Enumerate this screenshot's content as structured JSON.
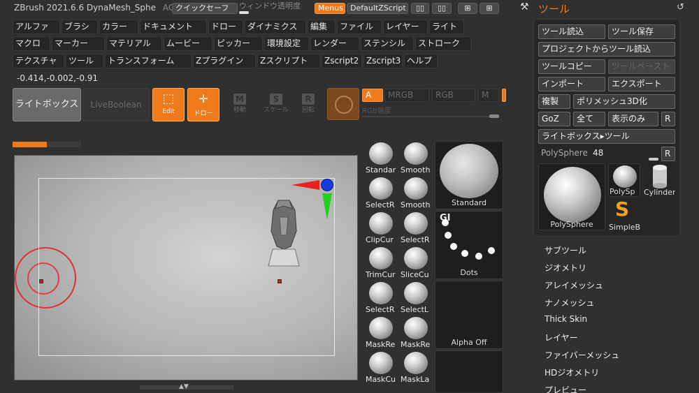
{
  "app": {
    "title": "ZBrush 2021.6.6 DynaMesh_Sphe",
    "ac_label": "AC"
  },
  "topbar": {
    "quicksave": "クイックセーフ",
    "transparency": "ウィンドウ透明度",
    "menus": "Menus",
    "default_zscript": "DefaultZScript"
  },
  "menus_row1": [
    "アルファ",
    "ブラシ",
    "カラー",
    "ドキュメント",
    "ドロー",
    "ダイナミクス",
    "編集",
    "ファイル",
    "レイヤー",
    "ライト"
  ],
  "menus_row2": [
    "マクロ",
    "マーカー",
    "マテリアル",
    "ムービー",
    "ピッカー",
    "環境設定",
    "レンダー",
    "ステンシル",
    "ストローク"
  ],
  "menus_row3": [
    "テクスチャ",
    "ツール",
    "トランスフォーム",
    "Zプラグイン",
    "Zスクリプト",
    "Zscript2",
    "Zscript3",
    "ヘルプ"
  ],
  "coordinates": "-0.414,-0.002,-0.91",
  "toolbar": {
    "lightbox": "ライトボックス",
    "live_boolean": "LiveBoolean",
    "edit": "Edit",
    "draw": "ドロー",
    "move": "移動",
    "scale": "スケール",
    "rotate": "回転",
    "modes": [
      "A",
      "MRGB",
      "RGB",
      "M"
    ],
    "rgb_intensity": "RGB強度"
  },
  "progress": {
    "fraction": 0.5
  },
  "brushes": [
    {
      "label": "Standar"
    },
    {
      "label": "Smooth"
    },
    {
      "label": "SelectR"
    },
    {
      "label": "Smooth"
    },
    {
      "label": "ClipCur"
    },
    {
      "label": "SelectR"
    },
    {
      "label": "TrimCur"
    },
    {
      "label": "SliceCu"
    },
    {
      "label": "SelectR"
    },
    {
      "label": "SelectL"
    },
    {
      "label": "MaskRe"
    },
    {
      "label": "MaskRe"
    },
    {
      "label": "MaskCu"
    },
    {
      "label": "MaskLa"
    }
  ],
  "previews": {
    "standard": "Standard",
    "dots": "Dots",
    "alpha": "Alpha Off",
    "gi": "GI"
  },
  "tool_panel": {
    "header": "ツール",
    "load_tool": "ツール読込",
    "save_tool": "ツール保存",
    "load_from_project": "プロジェクトからツール読込",
    "copy_tool": "ツールコピー",
    "paste_tool": "ツールペースト",
    "import": "インポート",
    "export": "エクスポート",
    "duplicate": "複製",
    "polymesh3d": "ポリメッシュ3D化",
    "goz": "GoZ",
    "all": "全て",
    "visible": "表示のみ",
    "r": "R",
    "lightbox_tool": "ライトボックス▸ツール",
    "current_tool": "PolySphere",
    "current_value": "48",
    "thumbs": [
      {
        "label": "PolySphere"
      },
      {
        "label": "PolySp"
      },
      {
        "label": "Cylinder"
      },
      {
        "label": "SimpleB"
      }
    ]
  },
  "subpalettes": [
    "サブツール",
    "ジオメトリ",
    "アレイメッシュ",
    "ナノメッシュ",
    "Thick Skin",
    "レイヤー",
    "ファイバーメッシュ",
    "HDジオメトリ",
    "プレビュー"
  ],
  "colors": {
    "accent": "#f07a1a",
    "background": "#303030",
    "panel": "#262626"
  }
}
